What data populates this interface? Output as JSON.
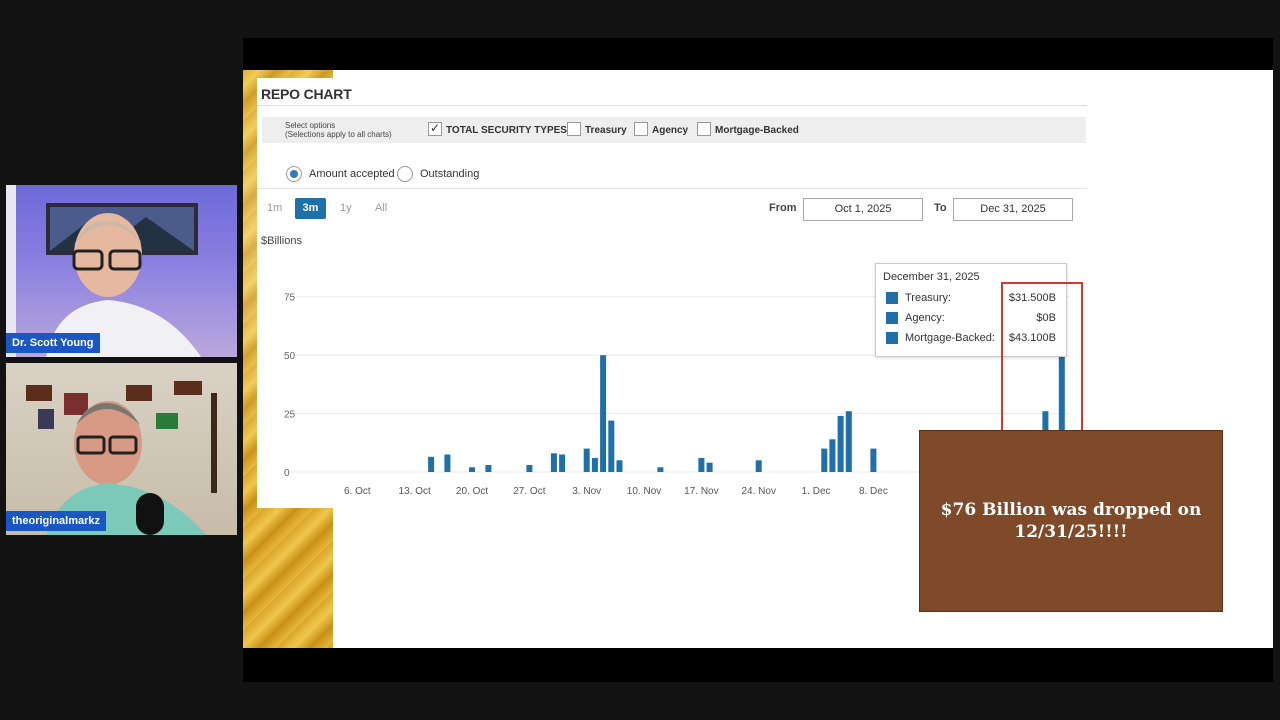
{
  "participants": [
    {
      "name": "Dr. Scott Young"
    },
    {
      "name": "theoriginalmarkz"
    }
  ],
  "repo_chart": {
    "title": "REPO CHART",
    "select_options_line1": "Select options",
    "select_options_line2": "(Selections apply to all charts)",
    "checkboxes": [
      {
        "label": "TOTAL SECURITY TYPES",
        "checked": true
      },
      {
        "label": "Treasury",
        "checked": false
      },
      {
        "label": "Agency",
        "checked": false
      },
      {
        "label": "Mortgage-Backed",
        "checked": false
      }
    ],
    "radios": [
      {
        "label": "Amount accepted",
        "selected": true
      },
      {
        "label": "Outstanding",
        "selected": false
      }
    ],
    "ranges": [
      {
        "label": "1m",
        "active": false
      },
      {
        "label": "3m",
        "active": true
      },
      {
        "label": "1y",
        "active": false
      },
      {
        "label": "All",
        "active": false
      }
    ],
    "from_label": "From",
    "from_value": "Oct 1, 2025",
    "to_label": "To",
    "to_value": "Dec 31, 2025",
    "unit_label": "$Billions",
    "tooltip": {
      "date": "December 31, 2025",
      "rows": [
        {
          "label": "Treasury:",
          "value": "$31.500B"
        },
        {
          "label": "Agency:",
          "value": "$0B"
        },
        {
          "label": "Mortgage-Backed:",
          "value": "$43.100B"
        }
      ]
    }
  },
  "banner": {
    "line1": "$76 Billion was dropped on",
    "line2": "12/31/25!!!!"
  },
  "colors": {
    "bar": "#1f6fa8",
    "highlight_box": "#d9352e",
    "banner_bg": "#7e4a2a",
    "nametag_bg": "#1a56c4"
  },
  "chart_data": {
    "type": "bar",
    "ylabel": "$Billions",
    "ylim": [
      0,
      95
    ],
    "yticks": [
      0,
      25,
      50,
      75
    ],
    "xlim": [
      "2025-09-29",
      "2026-01-01"
    ],
    "xticks": [
      {
        "date": "2025-10-06",
        "label": "6. Oct"
      },
      {
        "date": "2025-10-13",
        "label": "13. Oct"
      },
      {
        "date": "2025-10-20",
        "label": "20. Oct"
      },
      {
        "date": "2025-10-27",
        "label": "27. Oct"
      },
      {
        "date": "2025-11-03",
        "label": "3. Nov"
      },
      {
        "date": "2025-11-10",
        "label": "10. Nov"
      },
      {
        "date": "2025-11-17",
        "label": "17. Nov"
      },
      {
        "date": "2025-11-24",
        "label": "24. Nov"
      },
      {
        "date": "2025-12-01",
        "label": "1. Dec"
      },
      {
        "date": "2025-12-08",
        "label": "8. Dec"
      }
    ],
    "x": [
      "2025-10-15",
      "2025-10-17",
      "2025-10-20",
      "2025-10-22",
      "2025-10-27",
      "2025-10-30",
      "2025-10-31",
      "2025-11-03",
      "2025-11-04",
      "2025-11-05",
      "2025-11-06",
      "2025-11-07",
      "2025-11-12",
      "2025-11-17",
      "2025-11-18",
      "2025-11-24",
      "2025-12-02",
      "2025-12-03",
      "2025-12-04",
      "2025-12-05",
      "2025-12-08",
      "2025-12-29",
      "2025-12-31"
    ],
    "values": [
      6.5,
      7.5,
      2,
      3,
      3,
      8,
      7.5,
      10,
      6,
      50,
      22,
      5,
      2,
      6,
      4,
      5,
      10,
      14,
      24,
      26,
      10,
      26,
      75
    ]
  }
}
